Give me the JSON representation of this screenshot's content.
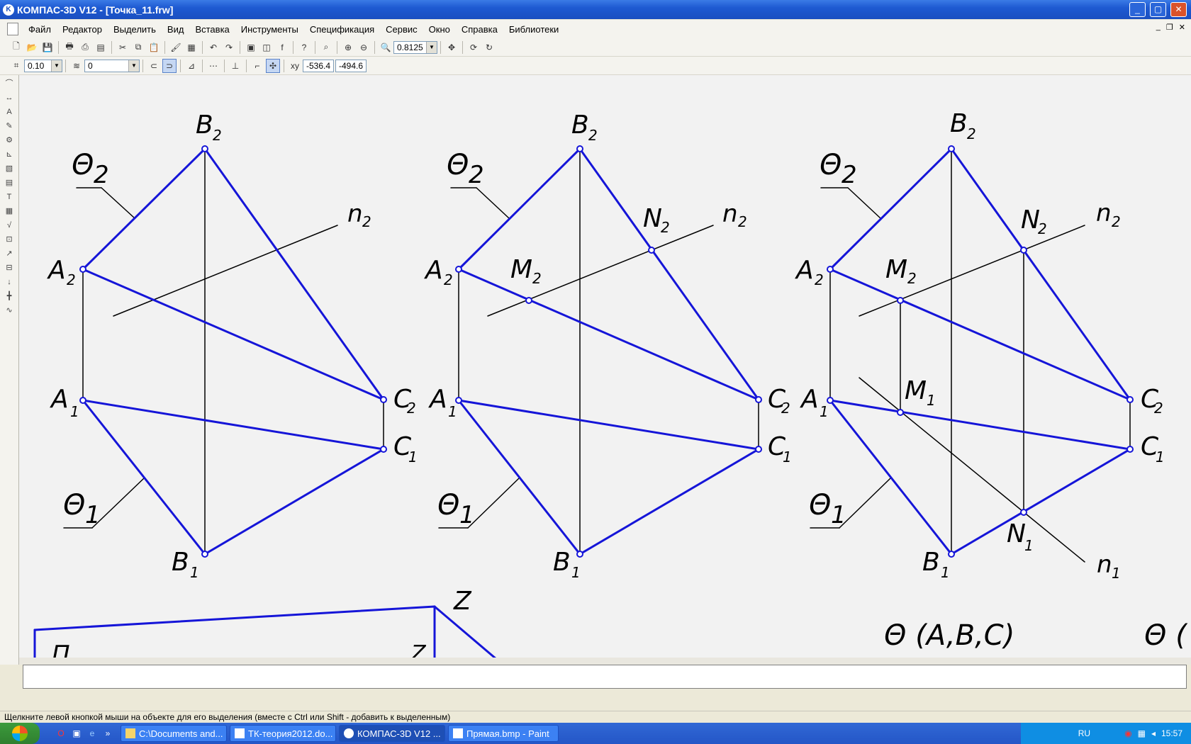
{
  "window": {
    "title": "КОМПАС-3D V12 - [Точка_11.frw]",
    "app_icon": "kompas-icon"
  },
  "menu": [
    "Файл",
    "Редактор",
    "Выделить",
    "Вид",
    "Вставка",
    "Инструменты",
    "Спецификация",
    "Сервис",
    "Окно",
    "Справка",
    "Библиотеки"
  ],
  "toolbar": {
    "zoom_value": "0.8125",
    "step_value": "0.10",
    "layer_value": "0",
    "coord_x": "-536.4",
    "coord_y": "-494.6"
  },
  "drawing": {
    "fig1": {
      "theta2": "Θ",
      "theta2_sub": "2",
      "theta1": "Θ",
      "theta1_sub": "1",
      "B2": "B",
      "A2": "A",
      "A1": "A",
      "B1": "B",
      "C2": "C",
      "C1": "C",
      "n2": "n",
      "sub1": "1",
      "sub2": "2"
    },
    "fig2": {
      "M2": "M",
      "N2": "N"
    },
    "fig3": {
      "M1": "M",
      "N1": "N",
      "n1": "n"
    },
    "axis_z": "Z",
    "axis_pi": "П",
    "plane_label": "Θ (A,B,C)",
    "plane_label_cut": "Θ ("
  },
  "status": "Щелкните левой кнопкой мыши на объекте для его выделения (вместе с Ctrl или Shift - добавить к выделенным)",
  "taskbar": {
    "items": [
      "C:\\Documents and...",
      "ТК-теория2012.do...",
      "КОМПАС-3D V12 ...",
      "Прямая.bmp - Paint"
    ],
    "lang": "RU",
    "clock": "15:57"
  },
  "colors": {
    "line": "#1515d8",
    "aux": "#000000",
    "canvas": "#f2f2f2"
  }
}
